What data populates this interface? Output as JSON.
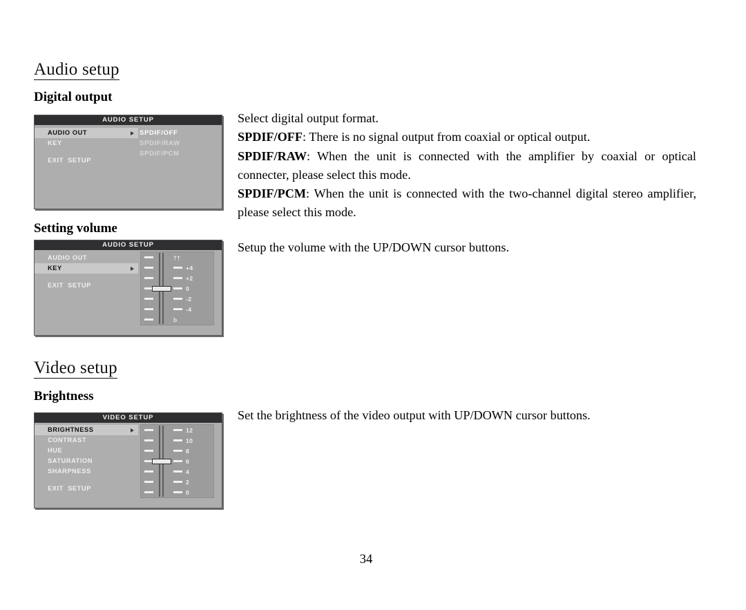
{
  "document": {
    "page_number": "34"
  },
  "sections": [
    {
      "id": "audio-setup",
      "title": "Audio setup",
      "subsections": [
        {
          "id": "digital-output",
          "title": "Digital output"
        },
        {
          "id": "setting-volume",
          "title": "Setting volume"
        }
      ]
    },
    {
      "id": "video-setup",
      "title": "Video setup",
      "subsections": [
        {
          "id": "brightness",
          "title": "Brightness"
        }
      ]
    }
  ],
  "paragraphs": {
    "digital_output_intro": "Select digital output format.",
    "spdif_off_label": "SPDIF/OFF",
    "spdif_off_text": ": There is no signal output from coaxial or optical output.",
    "spdif_raw_label": "SPDIF/RAW",
    "spdif_raw_text": ": When the unit is connected with the amplifier by coaxial or optical connecter, please select this mode.",
    "spdif_pcm_label": "SPDIF/PCM",
    "spdif_pcm_text": ": When the unit is connected with the two-channel digital stereo amplifier, please select this mode.",
    "setting_volume_text": "Setup the volume with the UP/DOWN cursor buttons.",
    "brightness_text": "Set the brightness of the video output with UP/DOWN cursor buttons."
  },
  "osd_panels": [
    {
      "id": "audio-setup-digital-output",
      "title": "AUDIO SETUP",
      "menu_items": [
        {
          "label": "AUDIO OUT",
          "selected": true,
          "arrow": true
        },
        {
          "label": "KEY",
          "selected": false,
          "arrow": false
        }
      ],
      "exit_row": "EXIT  SETUP",
      "options": [
        {
          "label": "SPDIF/OFF",
          "active": true
        },
        {
          "label": "SPDIF/RAW",
          "active": false
        },
        {
          "label": "SPDIF/PCM",
          "active": false
        }
      ]
    },
    {
      "id": "audio-setup-volume",
      "title": "AUDIO SETUP",
      "menu_items": [
        {
          "label": "AUDIO OUT",
          "selected": false,
          "arrow": false
        },
        {
          "label": "KEY",
          "selected": true,
          "arrow": true
        }
      ],
      "exit_row": "EXIT  SETUP",
      "slider": {
        "labels": [
          "††",
          "+4",
          "+2",
          "0",
          "-2",
          "-4",
          "b"
        ],
        "glyph_rows": [
          0,
          6
        ],
        "tick_count": 7,
        "knob_row_index": 3,
        "current_value": "0"
      }
    },
    {
      "id": "video-setup-brightness",
      "title": "VIDEO SETUP",
      "menu_items": [
        {
          "label": "BRIGHTNESS",
          "selected": true,
          "arrow": true
        },
        {
          "label": "CONTRAST",
          "selected": false,
          "arrow": false
        },
        {
          "label": "HUE",
          "selected": false,
          "arrow": false
        },
        {
          "label": "SATURATION",
          "selected": false,
          "arrow": false
        },
        {
          "label": "SHARPNESS",
          "selected": false,
          "arrow": false
        }
      ],
      "exit_row": "EXIT  SETUP",
      "slider": {
        "labels": [
          "12",
          "10",
          "8",
          "6",
          "4",
          "2",
          "0"
        ],
        "glyph_rows": [],
        "tick_count": 7,
        "knob_row_index": 3,
        "current_value": "6"
      }
    }
  ],
  "colors": {
    "osd_background": "#aeaeae",
    "osd_title_bar": "#2f2f31",
    "osd_selected_row": "#c9c9c9",
    "osd_text": "#f0f0f0",
    "slider_panel": "#9c9c9c",
    "page_background": "#ffffff"
  }
}
